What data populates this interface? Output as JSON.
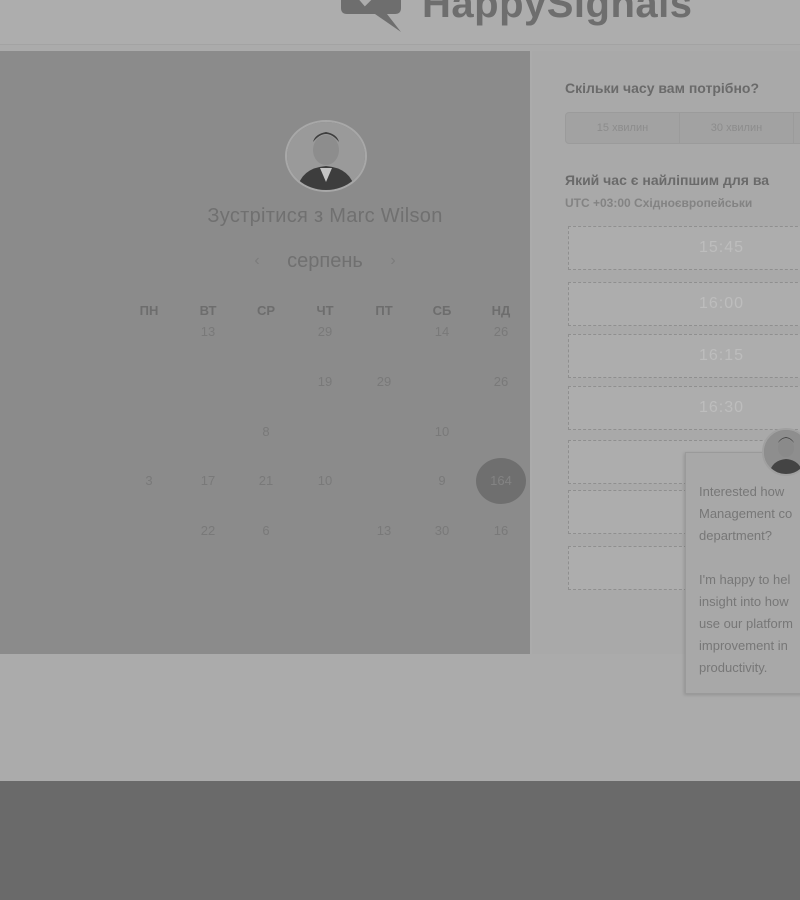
{
  "brand": {
    "name": "HappySignals",
    "logo_icon": "speech-bubble-logo-icon"
  },
  "scheduler": {
    "host_heading": "Зустрітися з Marc Wilson",
    "month": "серпень",
    "prev_icon": "chevron-left-icon",
    "next_icon": "chevron-right-icon",
    "weekdays": [
      "ПН",
      "ВТ",
      "СР",
      "ЧТ",
      "ПТ",
      "СБ",
      "НД"
    ],
    "day_rows": [
      [
        "",
        "13",
        "",
        "29",
        "",
        "14",
        "26"
      ],
      [
        "",
        "",
        "",
        "19",
        "29",
        "",
        "26"
      ],
      [
        "",
        "",
        "8",
        "",
        "",
        "10",
        ""
      ],
      [
        "3",
        "17",
        "21",
        "10",
        "",
        "9",
        "164"
      ],
      [
        "",
        "22",
        "6",
        "",
        "13",
        "30",
        "16"
      ]
    ],
    "selected_day": "164"
  },
  "booking": {
    "duration_question": "Скільки часу вам потрібно?",
    "duration_options": [
      "15 хвилин",
      "30 хвилин"
    ],
    "time_question": "Який час є найліпшим для ва",
    "timezone": "UTC +03:00 Східноєвропейськи",
    "slots": [
      "15:45",
      "16:00",
      "16:15",
      "16:30",
      "",
      "",
      ""
    ]
  },
  "chat": {
    "message": "Interested how\nManagement co\ndepartment?\n\nI'm happy to hel\ninsight into how\nuse our platform\nimprovement in\nproductivity."
  },
  "colors": {
    "overlay": "#6a6a6a",
    "selected_day": "#6f6f6f"
  }
}
